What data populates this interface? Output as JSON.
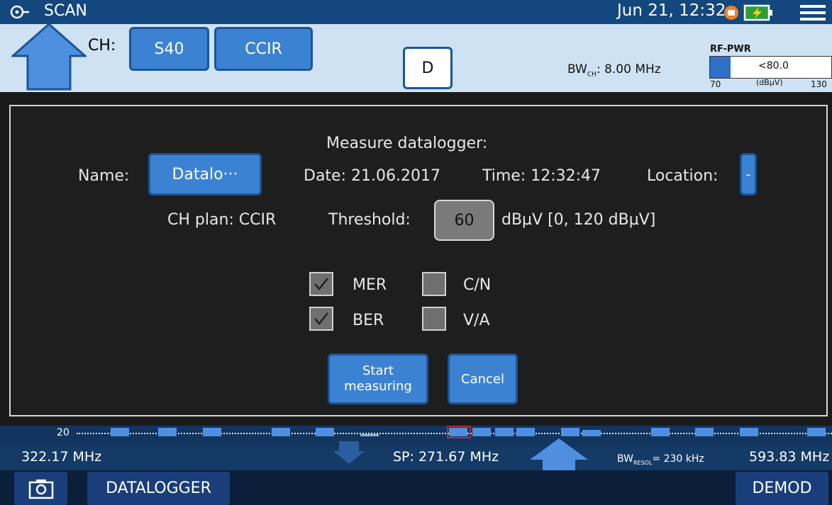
{
  "titlebar": {
    "title": "SCAN",
    "datetime": "Jun 21, 12:32",
    "icons": [
      "satellite-icon",
      "alarm-icon",
      "battery-charging-icon",
      "menu-icon"
    ]
  },
  "channel_bar": {
    "ch_label": "CH:",
    "channel": "S40",
    "plan": "CCIR",
    "mode": "D",
    "bw_label": "BW",
    "bw_sub": "CH",
    "bw_value": ": 8.00 MHz",
    "rf": {
      "title": "RF-PWR",
      "value": "<80.0",
      "unit": "(dBµV)",
      "min": "70",
      "max": "130",
      "level_fraction": 0.17
    }
  },
  "dialog": {
    "title": "Measure datalogger:",
    "name_label": "Name:",
    "name_value": "Datalo···",
    "date": "Date: 21.06.2017",
    "time": "Time: 12:32:47",
    "location_label": "Location:",
    "location_value": "-",
    "ch_plan": "CH plan: CCIR",
    "threshold_label": "Threshold:",
    "threshold_value": "60",
    "threshold_range": "dBµV [0, 120 dBµV]",
    "options": [
      {
        "label": "MER",
        "checked": true
      },
      {
        "label": "C/N",
        "checked": false
      },
      {
        "label": "BER",
        "checked": true
      },
      {
        "label": "V/A",
        "checked": false
      }
    ],
    "start_button": [
      "Start",
      "measuring"
    ],
    "cancel_button": "Cancel"
  },
  "spectrum": {
    "ref_level": "20",
    "start_freq": "322.17 MHz",
    "span": "SP: 271.67 MHz",
    "bw_resol_label": "BW",
    "bw_resol_sub": "RESOL",
    "bw_resol_value": "= 230 kHz",
    "end_freq": "593.83 MHz"
  },
  "bottom_bar": {
    "screenshot_icon": "screenshot-icon",
    "left_tab": "DATALOGGER",
    "right_tab": "DEMOD"
  },
  "colors": {
    "title_bar": "#13477e",
    "channel_bar": "#cfe2f4",
    "button_blue": "#3c82d2",
    "dialog_bg": "#1e1e1e"
  }
}
